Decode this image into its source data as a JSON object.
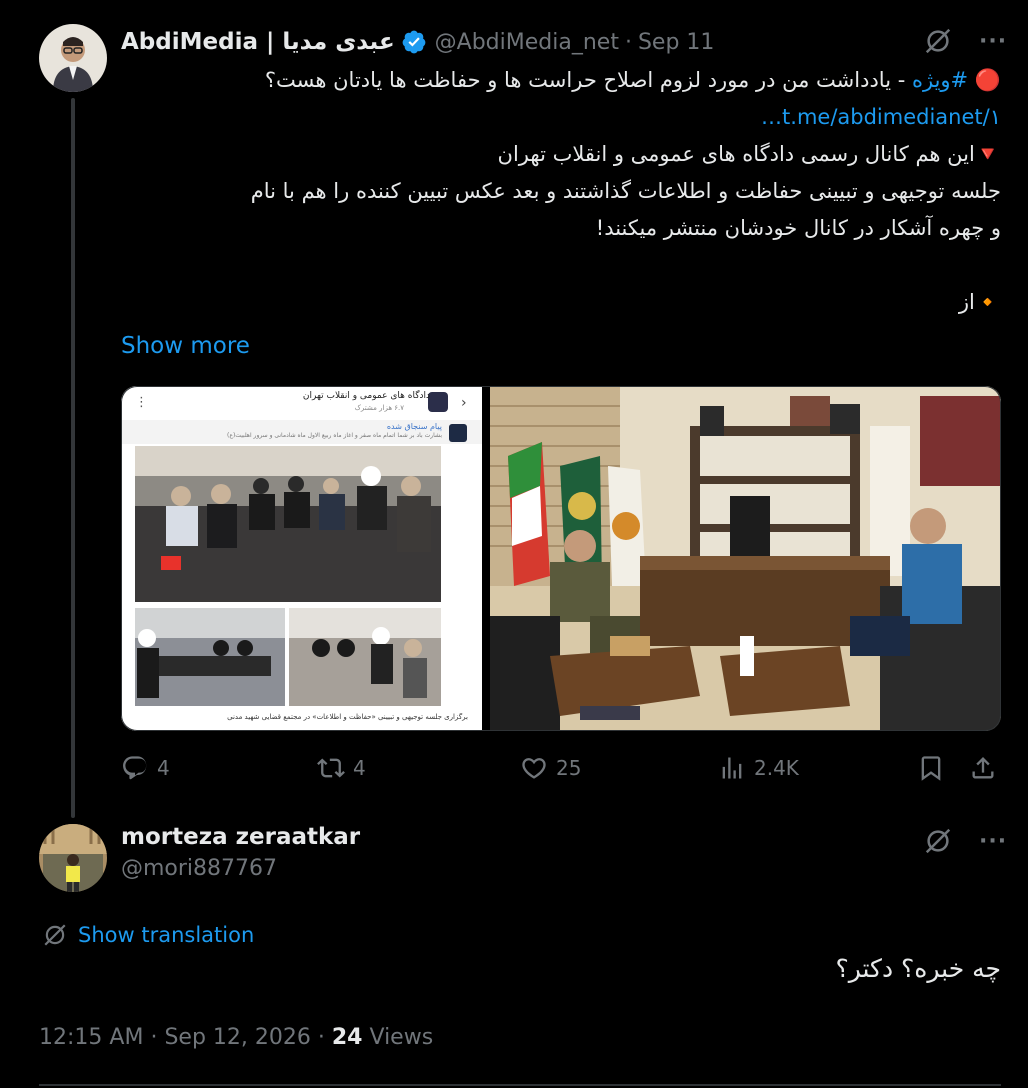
{
  "tweet": {
    "display_name": "AbdiMedia | عبدی مدیا",
    "handle": "@AbdiMedia_net",
    "separator": "·",
    "date": "Sep 11",
    "lines": [
      {
        "emoji": "🔴",
        "hashtag": "#ویژه",
        "text": " - یادداشت من در مورد لزوم اصلاح حراست ها و حفاظت ها یادتان هست؟"
      },
      {
        "link": "t.me/abdimedianet/۱…"
      },
      {
        "text": "🔻این هم کانال رسمی دادگاه های عمومی و انقلاب تهران"
      },
      {
        "text": "جلسه توجیهی و تبیینی حفاظت و اطلاعات گذاشتند و بعد عکس تبیین کننده را هم با نام"
      },
      {
        "text": "و چهره آشکار در کانال خودشان منتشر میکنند!"
      },
      {
        "text": ""
      },
      {
        "text": "🔸از"
      }
    ],
    "show_more": "Show more",
    "media": {
      "left": {
        "channel_title": "دادگاه های عمومی و انقلاب تهران",
        "members": "۶.۷ هزار مشترک",
        "pinned": "پیام سنجاق شده",
        "pinned_text": "بشارت باد بر شما اتمام ماه صفر و آغاز ماه ربیع الاول ماه شادمانی و سرور اهلبیت(ع)",
        "caption": "برگزاری جلسه توجیهی و تبیینی «حفاظت و اطلاعات» در مجتمع قضایی شهید مدنی"
      }
    },
    "actions": {
      "replies": "4",
      "reposts": "4",
      "likes": "25",
      "views": "2.4K"
    }
  },
  "reply": {
    "display_name": "morteza zeraatkar",
    "handle": "@mori887767",
    "translate_label": "Show translation",
    "text": "چه خبره؟ دکتر؟"
  },
  "meta": {
    "time": "12:15 AM",
    "separator": "·",
    "date": "Sep 12, 2026",
    "views_count": "24",
    "views_label": "Views"
  },
  "colors": {
    "accent": "#1d9bf0",
    "muted": "#71767b",
    "text": "#e7e9ea",
    "background": "#000000",
    "border": "#2f3336"
  },
  "icons": [
    "grok-icon",
    "more-icon",
    "reply-icon",
    "repost-icon",
    "like-icon",
    "views-icon",
    "bookmark-icon",
    "share-icon",
    "verified-icon",
    "translate-icon"
  ]
}
